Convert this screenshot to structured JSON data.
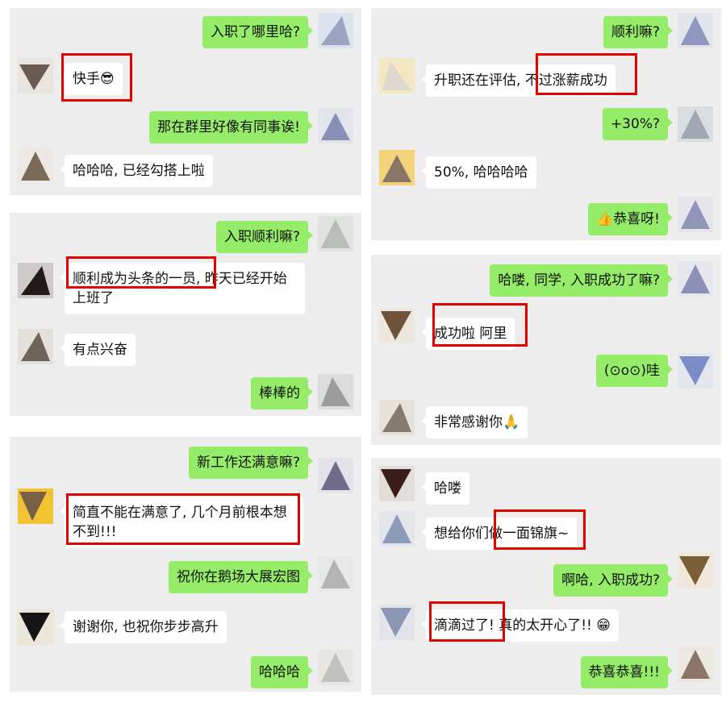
{
  "panels": [
    {
      "messages": [
        {
          "side": "right",
          "text": "入职了哪里哈?"
        },
        {
          "side": "left",
          "text": "快手😎"
        },
        {
          "side": "right",
          "text": "那在群里好像有同事诶!"
        },
        {
          "side": "left",
          "text": "哈哈哈, 已经勾搭上啦"
        }
      ]
    },
    {
      "messages": [
        {
          "side": "right",
          "text": "入职顺利嘛?"
        },
        {
          "side": "left",
          "text": "顺利成为头条的一员, 昨天已经开始上班了"
        },
        {
          "side": "left",
          "text": "有点兴奋"
        },
        {
          "side": "right",
          "text": "棒棒的"
        }
      ]
    },
    {
      "messages": [
        {
          "side": "right",
          "text": "新工作还满意嘛?"
        },
        {
          "side": "left",
          "text": "简直不能在满意了, 几个月前根本想不到!!!"
        },
        {
          "side": "right",
          "text": "祝你在鹅场大展宏图"
        },
        {
          "side": "left",
          "text": "谢谢你, 也祝你步步高升"
        },
        {
          "side": "right",
          "text": "哈哈哈"
        }
      ]
    },
    {
      "messages": [
        {
          "side": "right",
          "text": "顺利嘛?"
        },
        {
          "side": "left",
          "text": "升职还在评估, 不过涨薪成功"
        },
        {
          "side": "right",
          "text": "+30%?"
        },
        {
          "side": "left",
          "text": "50%, 哈哈哈哈"
        },
        {
          "side": "right",
          "text": "👍恭喜呀!"
        }
      ]
    },
    {
      "messages": [
        {
          "side": "right",
          "text": "哈喽, 同学, 入职成功了嘛?"
        },
        {
          "side": "left",
          "text": "成功啦  阿里"
        },
        {
          "side": "right",
          "text": "(⊙o⊙)哇"
        },
        {
          "side": "left",
          "text": "非常感谢你🙏"
        }
      ]
    },
    {
      "messages": [
        {
          "side": "left",
          "text": "哈喽"
        },
        {
          "side": "left",
          "text": "想给你们做一面锦旗~"
        },
        {
          "side": "right",
          "text": "啊哈, 入职成功?"
        },
        {
          "side": "left",
          "text": "滴滴过了! 真的太开心了!! 😁"
        },
        {
          "side": "right",
          "text": "恭喜恭喜!!!"
        }
      ]
    }
  ],
  "colors": {
    "sent_bubble": "#95ec69",
    "received_bubble": "#ffffff",
    "panel_bg": "#ededed",
    "highlight": "#e00000"
  }
}
